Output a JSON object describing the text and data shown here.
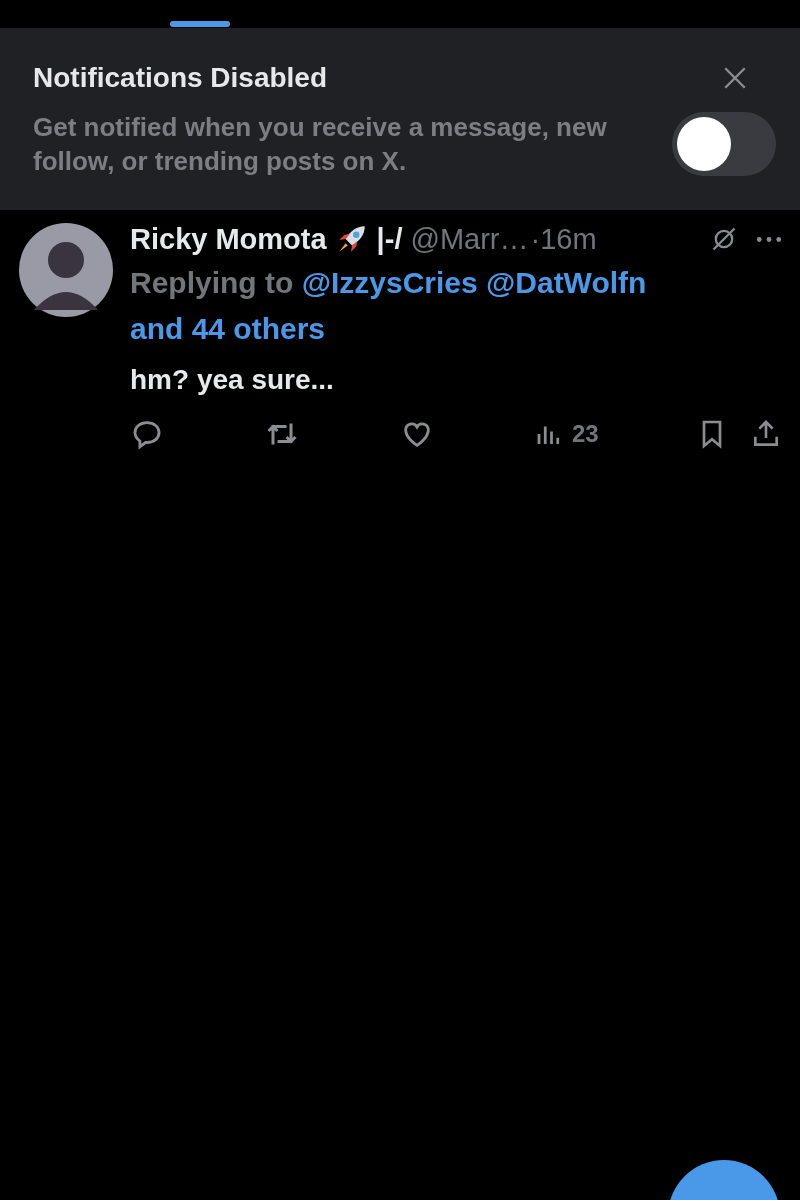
{
  "tab_indicator": {
    "selected": true
  },
  "banner": {
    "title": "Notifications Disabled",
    "message": "Get notified when you receive a message, new follow, or trending posts on X.",
    "toggle": {
      "on": false
    }
  },
  "post": {
    "name": "Ricky Momota",
    "name_suffix": "|-/",
    "handle": "@Marr…",
    "time": "·16m",
    "replying_label": "Replying to",
    "mentions": [
      "@IzzysCries",
      "@DatWolfn",
      "and 44 others"
    ],
    "text": "hm? yea sure...",
    "views": "23"
  }
}
